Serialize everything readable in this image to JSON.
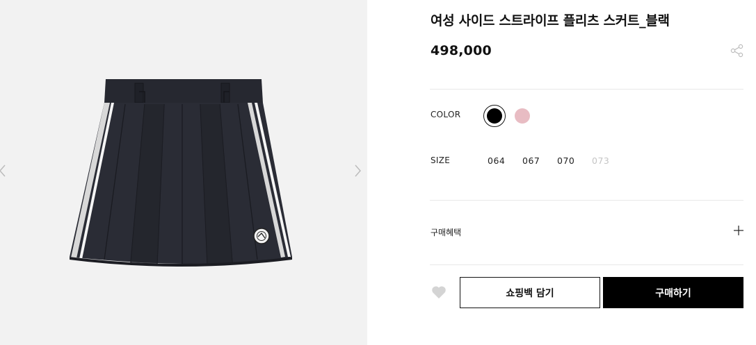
{
  "gallery": {
    "prev_icon": "chevron-left-icon",
    "next_icon": "chevron-right-icon"
  },
  "product": {
    "title": "여성 사이드 스트라이프 플리츠 스커트_블랙",
    "price": "498,000",
    "share_icon": "share-icon"
  },
  "options": {
    "color_label": "COLOR",
    "colors": [
      {
        "name": "black",
        "hex": "#000000",
        "selected": true
      },
      {
        "name": "pink",
        "hex": "#e8bcc3",
        "selected": false
      }
    ],
    "size_label": "SIZE",
    "sizes": [
      {
        "label": "064",
        "available": true
      },
      {
        "label": "067",
        "available": true
      },
      {
        "label": "070",
        "available": true
      },
      {
        "label": "073",
        "available": false
      }
    ]
  },
  "benefit": {
    "label": "구매혜택",
    "toggle_icon": "plus-icon"
  },
  "actions": {
    "wishlist_icon": "heart-icon",
    "cart_label": "쇼핑백 담기",
    "buy_label": "구매하기"
  },
  "colors": {
    "gallery_bg": "#f2f2f2",
    "divider": "#e8e8e8",
    "disabled_text": "#c4c4c4",
    "primary": "#000000"
  }
}
